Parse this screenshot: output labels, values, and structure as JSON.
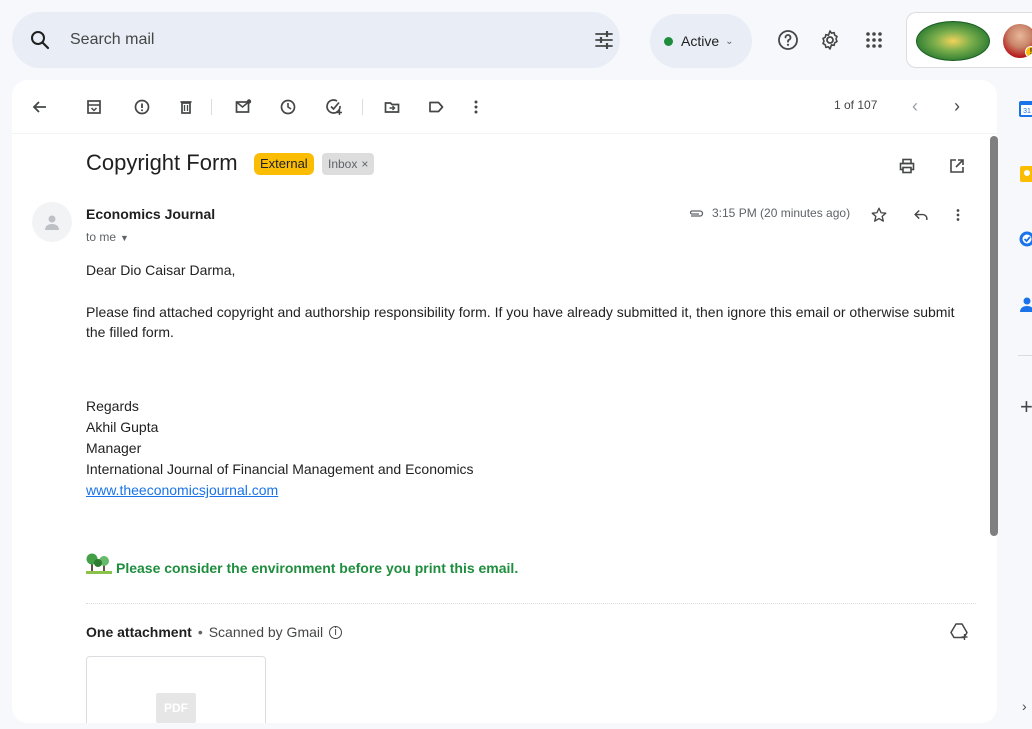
{
  "search": {
    "placeholder": "Search mail"
  },
  "status": {
    "label": "Active"
  },
  "toolbar": {
    "pager": "1 of 107"
  },
  "email": {
    "subject": "Copyright Form",
    "tags": [
      "External",
      "Inbox"
    ],
    "sender": "Economics Journal",
    "recipient": "to me",
    "timestamp": "3:15 PM (20 minutes ago)",
    "greeting": "Dear Dio Caisar Darma,",
    "paragraph": "Please find attached copyright and authorship responsibility form. If you have already submitted it, then ignore this email or otherwise submit the filled form.",
    "signature": [
      "Regards",
      "Akhil Gupta",
      "Manager",
      "International Journal of Financial Management and Economics"
    ],
    "link": "www.theeconomicsjournal.com",
    "eco_note": "Please consider the environment before you print this email."
  },
  "attachments": {
    "title": "One attachment",
    "scanned": "Scanned by Gmail",
    "file_type": "PDF"
  },
  "colors": {
    "accent": "#1a73e8",
    "tag_external": "#fbbc04",
    "active_dot": "#1e8e3e",
    "eco_green": "#1e8e3e"
  }
}
